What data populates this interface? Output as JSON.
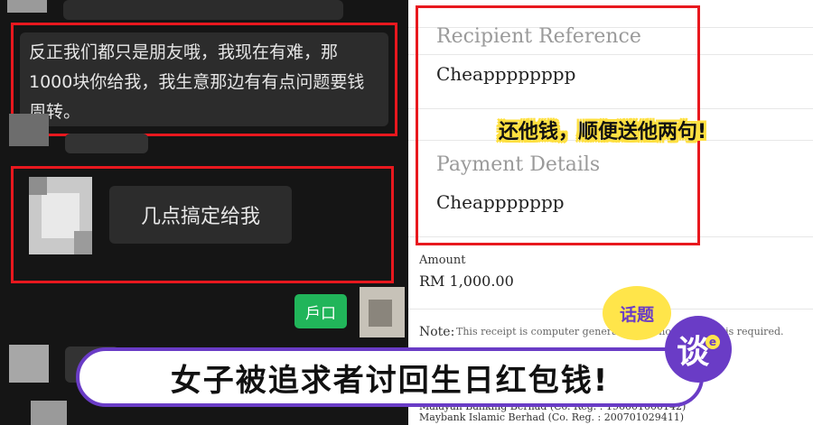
{
  "chat": {
    "message1": "反正我们都只是朋友哦，我现在有难，那1000块你给我，我生意那边有有点问题要钱周转。",
    "message2": "几点搞定给我",
    "sent_bubble": "戶口"
  },
  "receipt": {
    "recipient_reference_label": "Recipient Reference",
    "recipient_reference_value": "Cheapppppppp",
    "payment_details_label": "Payment Details",
    "payment_details_value": "Cheappppppp",
    "amount_label": "Amount",
    "amount_value": "RM 1,000.00",
    "note_label": "Note:",
    "note_text": "This receipt is computer generated and no signature is required.",
    "footer_line1": "Malayan Banking Berhad (Co. Reg. : 196001000142)",
    "footer_line2": "Maybank Islamic Berhad (Co. Reg. : 200701029411)"
  },
  "overlay": {
    "caption": "还他钱，顺便送他两句!",
    "headline": "女子被追求者讨回生日红包钱!",
    "topic_badge": "话题",
    "talk_logo": "谈",
    "talk_logo_sup": "e"
  },
  "colors": {
    "highlight": "#e8181e",
    "brand_purple": "#6a3cc6",
    "brand_yellow": "#ffe54a",
    "send_green": "#21b55a"
  }
}
